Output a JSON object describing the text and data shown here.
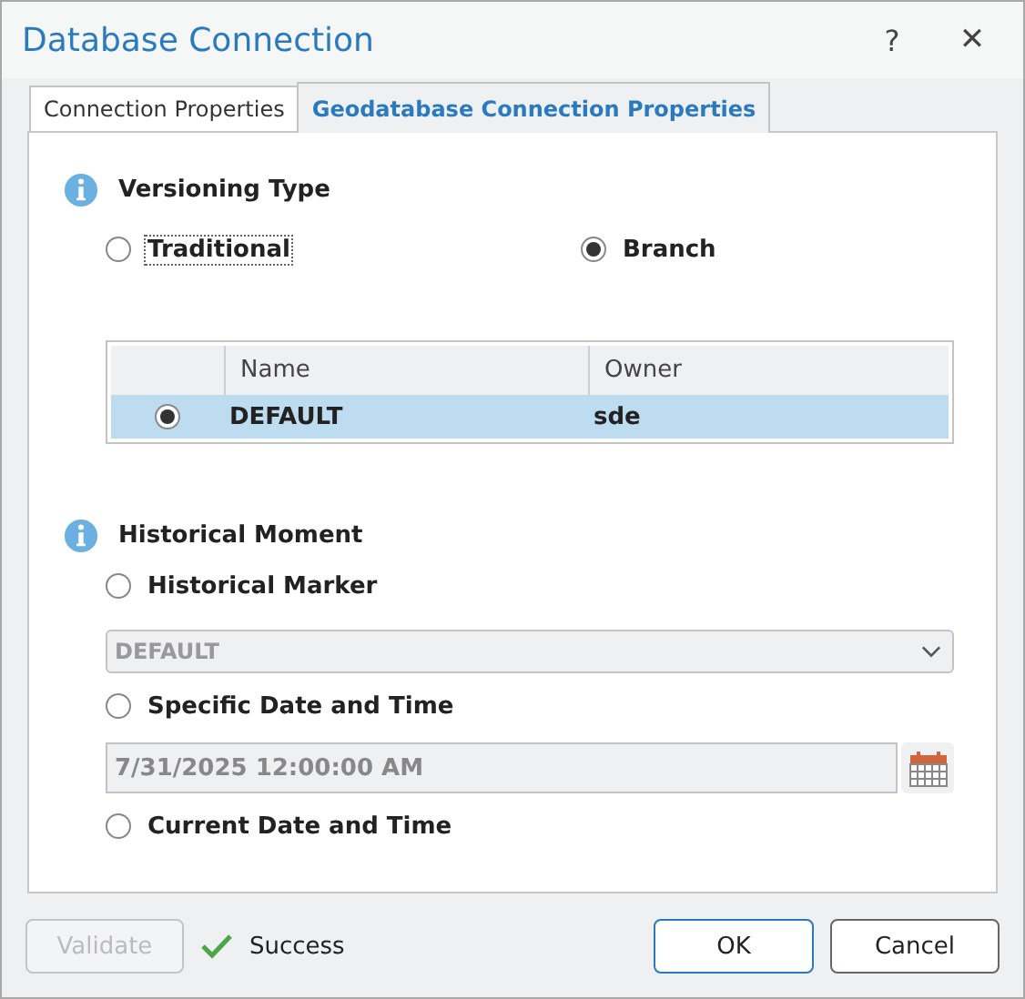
{
  "window": {
    "title": "Database Connection",
    "help": "?",
    "close": "✕"
  },
  "tabs": [
    {
      "label": "Connection Properties",
      "selected": false
    },
    {
      "label": "Geodatabase Connection Properties",
      "selected": true
    }
  ],
  "versioning": {
    "heading": "Versioning Type",
    "options": [
      {
        "label": "Traditional",
        "selected": false,
        "focused": true
      },
      {
        "label": "Branch",
        "selected": true,
        "focused": false
      }
    ],
    "table": {
      "columns": [
        "Name",
        "Owner"
      ],
      "rows": [
        {
          "name": "DEFAULT",
          "owner": "sde",
          "selected": true
        }
      ]
    }
  },
  "historical": {
    "heading": "Historical Moment",
    "items": [
      {
        "kind": "radio",
        "label": "Historical Marker",
        "selected": false
      },
      {
        "kind": "dropdown",
        "value": "DEFAULT",
        "disabled": true
      },
      {
        "kind": "radio",
        "label": "Specific Date and Time",
        "selected": false
      },
      {
        "kind": "date",
        "value": "7/31/2025 12:00:00 AM",
        "disabled": true
      },
      {
        "kind": "radio",
        "label": "Current Date and Time",
        "selected": false
      }
    ]
  },
  "footer": {
    "validate": {
      "label": "Validate",
      "disabled": true
    },
    "status": "Success",
    "ok": "OK",
    "cancel": "Cancel"
  }
}
